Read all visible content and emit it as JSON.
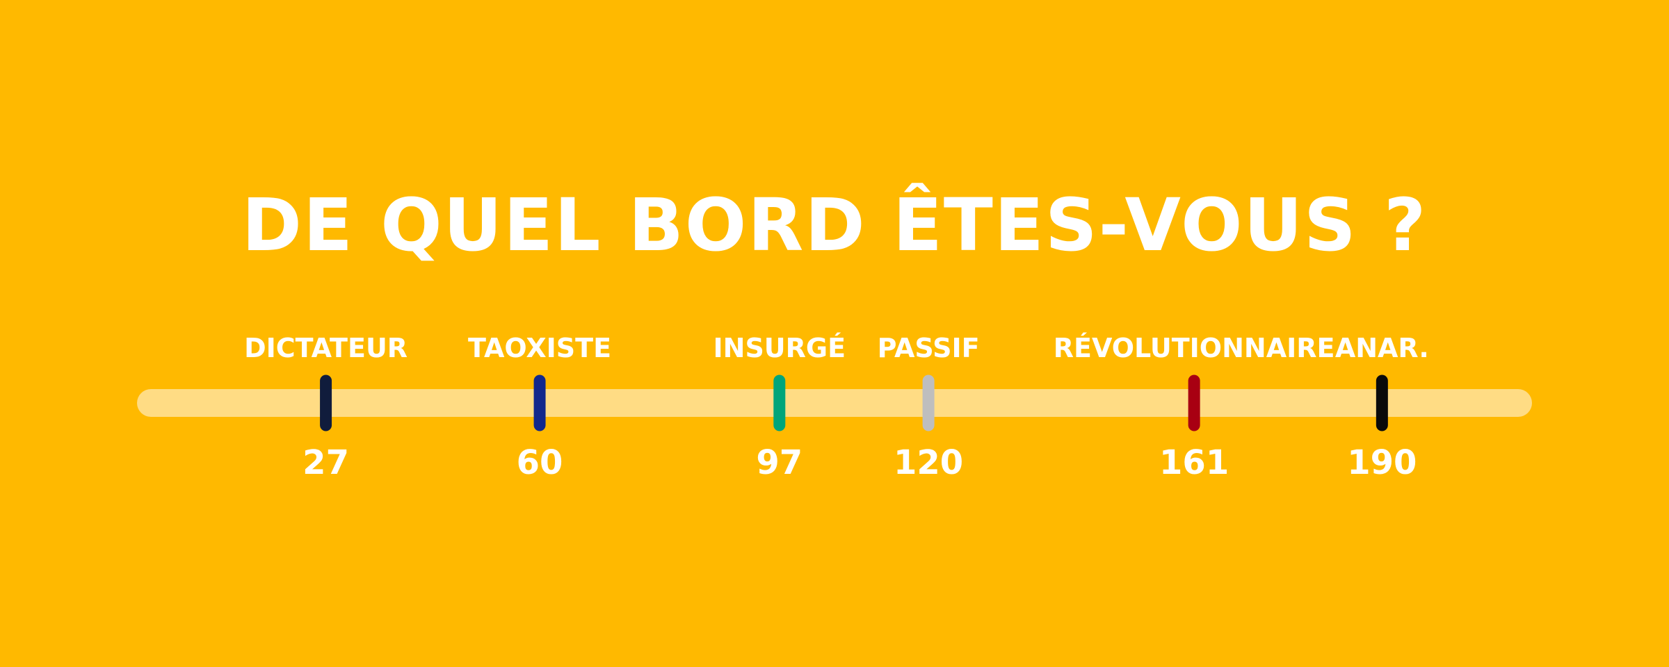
{
  "title": "DE QUEL BORD ÊTES-VOUS ?",
  "colors": {
    "background": "#FFB900",
    "track": "#FFDC84",
    "text": "#FFFFFF"
  },
  "chart_data": {
    "type": "scatter",
    "title": "DE QUEL BORD ÊTES-VOUS ?",
    "xlabel": "",
    "ylabel": "",
    "xlim": [
      0,
      211
    ],
    "grid": false,
    "categories": [
      "DICTATEUR",
      "TAOXISTE",
      "INSURGÉ",
      "PASSIF",
      "RÉVOLUTIONNAIRE",
      "ANAR."
    ],
    "values": [
      27,
      60,
      97,
      120,
      161,
      190
    ],
    "value_labels": [
      "27",
      "60",
      "97",
      "120",
      "161",
      "190"
    ],
    "colors": [
      "#101C3C",
      "#12288C",
      "#00A57A",
      "#BEBEBE",
      "#A80012",
      "#0A0A0A"
    ]
  }
}
